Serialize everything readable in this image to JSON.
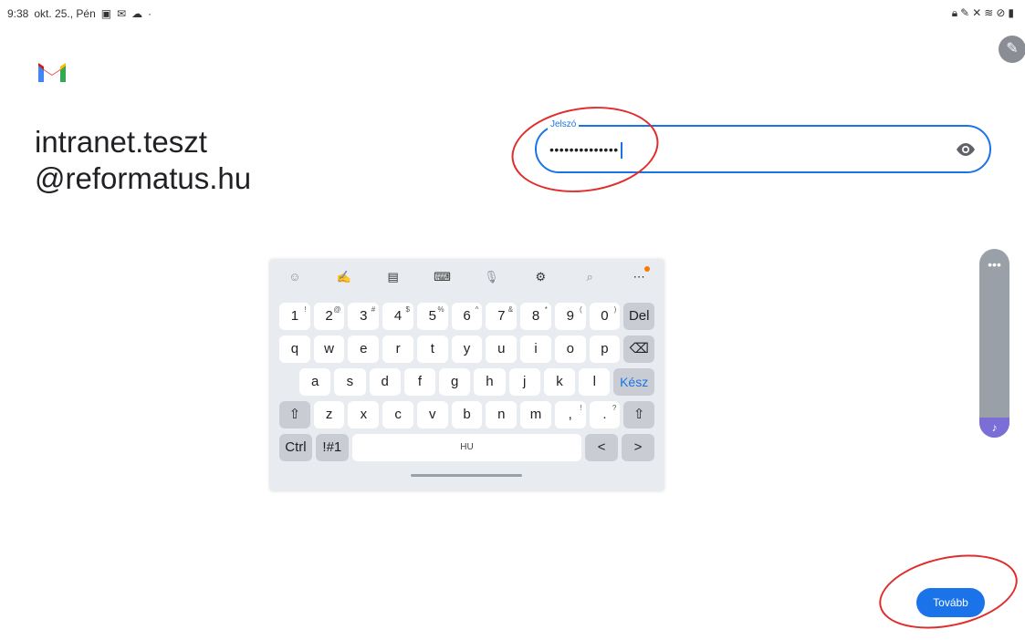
{
  "status_bar": {
    "time": "9:38",
    "date": "okt. 25., Pén",
    "left_icons": [
      "gallery-icon",
      "gmail-notification-icon",
      "cloud-icon"
    ],
    "right_icons": [
      "lock-icon",
      "edit-icon",
      "mute-icon",
      "wifi-icon",
      "block-icon",
      "battery-icon"
    ]
  },
  "account": {
    "line1": "intranet.teszt",
    "line2": "@reformatus.hu"
  },
  "password_field": {
    "label": "Jelszó",
    "value": "••••••••••••••"
  },
  "keyboard": {
    "toolbar": [
      "emoji-icon",
      "handwriting-icon",
      "clipboard-icon",
      "keyboard-mode-icon",
      "mic-icon",
      "settings-icon",
      "search-icon",
      "more-icon"
    ],
    "row1": [
      {
        "k": "1",
        "s": "!"
      },
      {
        "k": "2",
        "s": "@"
      },
      {
        "k": "3",
        "s": "#"
      },
      {
        "k": "4",
        "s": "$"
      },
      {
        "k": "5",
        "s": "%"
      },
      {
        "k": "6",
        "s": "^"
      },
      {
        "k": "7",
        "s": "&"
      },
      {
        "k": "8",
        "s": "*"
      },
      {
        "k": "9",
        "s": "("
      },
      {
        "k": "0",
        "s": ")"
      }
    ],
    "del_label": "Del",
    "row2": [
      "q",
      "w",
      "e",
      "r",
      "t",
      "y",
      "u",
      "i",
      "o",
      "p"
    ],
    "row3": [
      "a",
      "s",
      "d",
      "f",
      "g",
      "h",
      "j",
      "k",
      "l"
    ],
    "done_label": "Kész",
    "row4": [
      "z",
      "x",
      "c",
      "v",
      "b",
      "n",
      "m",
      ",",
      "."
    ],
    "row4_subs": [
      "",
      "",
      "",
      "",
      "",
      "",
      "",
      "!",
      "?"
    ],
    "ctrl_label": "Ctrl",
    "symbols_label": "!#1",
    "space_label": "HU",
    "left_arrow": "<",
    "right_arrow": ">"
  },
  "side_panel": {
    "dots": "•••",
    "bottom_icon": "music-note-icon"
  },
  "next_button": "Tovább",
  "colors": {
    "accent": "#1a73e8",
    "annotation": "#e22b2b"
  }
}
